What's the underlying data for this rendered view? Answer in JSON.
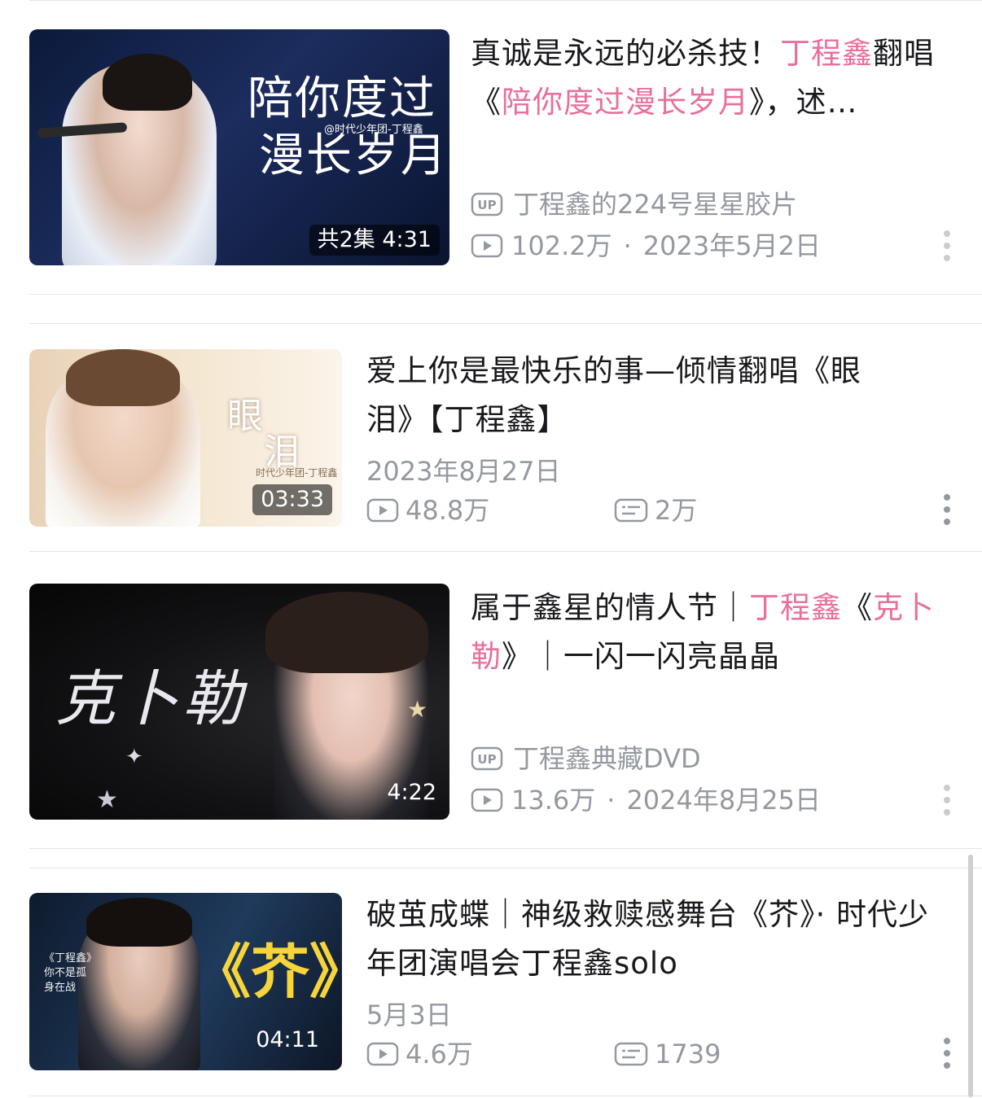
{
  "videos": [
    {
      "title_parts": [
        {
          "text": "真诚是永远的必杀技！",
          "hl": false
        },
        {
          "text": "丁程鑫",
          "hl": true
        },
        {
          "text": "翻唱《",
          "hl": false
        },
        {
          "text": "陪你度过漫长岁月",
          "hl": true
        },
        {
          "text": "》，述…",
          "hl": false
        }
      ],
      "uploader": "丁程鑫的224号星星胶片",
      "views": "102.2万",
      "date": "2023年5月2日",
      "duration": "共2集 4:31",
      "thumb_text": {
        "line1": "陪你度过",
        "line2": "漫长岁月",
        "sub": "@时代少年团-丁程鑫"
      }
    },
    {
      "title_parts": [
        {
          "text": "爱上你是最快乐的事—倾情翻唱《眼泪》【丁程鑫】",
          "hl": false
        }
      ],
      "date": "2023年8月27日",
      "views": "48.8万",
      "danmaku": "2万",
      "duration": "03:33",
      "thumb_text": {
        "line1": "眼",
        "line2": "泪",
        "sub": "时代少年团-丁程鑫"
      }
    },
    {
      "title_parts": [
        {
          "text": "属于鑫星的情人节｜",
          "hl": false
        },
        {
          "text": "丁程鑫",
          "hl": true
        },
        {
          "text": "《",
          "hl": false
        },
        {
          "text": "克卜勒",
          "hl": true
        },
        {
          "text": "》｜一闪一闪亮晶晶",
          "hl": false
        }
      ],
      "uploader": "丁程鑫典藏DVD",
      "views": "13.6万",
      "date": "2024年8月25日",
      "duration": "4:22",
      "thumb_text": {
        "line1": "克卜勒"
      }
    },
    {
      "title_parts": [
        {
          "text": "破茧成蝶｜神级救赎感舞台《芥》· 时代少年团演唱会丁程鑫solo",
          "hl": false
        }
      ],
      "date": "5月3日",
      "views": "4.6万",
      "danmaku": "1739",
      "duration": "04:11",
      "thumb_text": {
        "line1": "《芥》",
        "sub": "《丁程鑫》你不是孤身在战"
      }
    }
  ],
  "icons": {
    "up_badge": "UP",
    "more": "more-vertical-icon",
    "play": "play-count-icon",
    "danmaku": "danmaku-icon"
  },
  "colors": {
    "highlight": "#e96f9c",
    "meta": "#9499a0",
    "title": "#18191c"
  }
}
